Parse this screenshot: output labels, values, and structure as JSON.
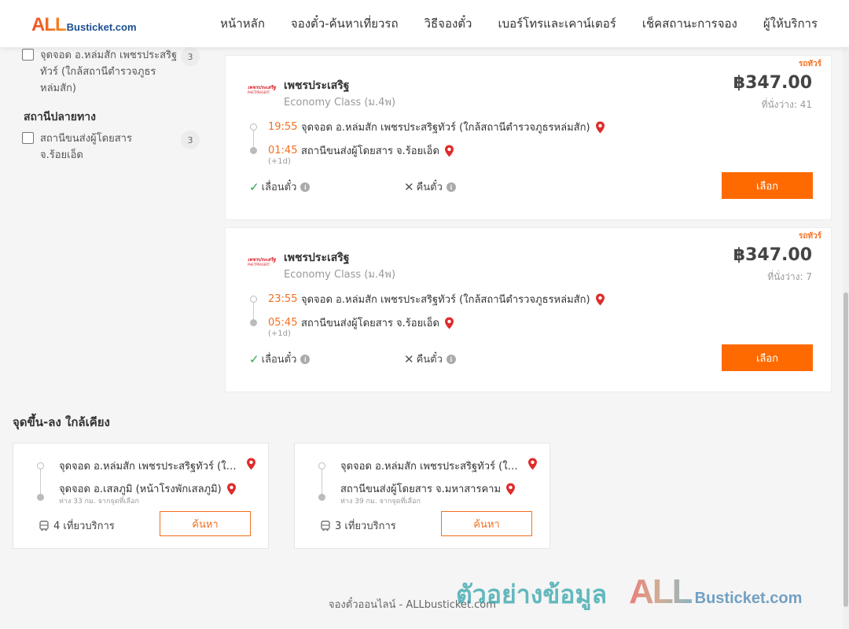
{
  "header": {
    "logo_all": "ALL",
    "logo_rest": "Busticket.com",
    "nav": [
      "หน้าหลัก",
      "จองตั๋ว-ค้นหาเที่ยวรถ",
      "วิธีจองตั๋ว",
      "เบอร์โทรและเคาน์เตอร์",
      "เช็คสถานะการจอง",
      "ผู้ให้บริการ"
    ]
  },
  "filters": {
    "origin_item": {
      "label": "จุดจอด อ.หล่มสัก เพชรประสริฐทัวร์ (ใกล้สถานีตำรวจภูธรหล่มสัก)",
      "count": "3"
    },
    "destination_heading": "สถานีปลายทาง",
    "destination_item": {
      "label": "สถานีขนส่งผู้โดยสาร จ.ร้อยเอ็ด",
      "count": "3"
    }
  },
  "trips": [
    {
      "tag": "รถทัวร์",
      "operator_logo_l1": "เพชรประเสริฐ",
      "operator_logo_l2": "PHETPRASERT",
      "operator": "เพชรประเสริฐ",
      "class": "Economy Class (ม.4พ)",
      "price": "฿347.00",
      "seats": "ที่นั่งว่าง: 41",
      "depart_time": "19:55",
      "depart_stop": "จุดจอด อ.หล่มสัก เพชรประสริฐทัวร์ (ใกล้สถานีตำรวจภูธรหล่มสัก)",
      "arrive_time": "01:45",
      "arrive_stop": "สถานีขนส่งผู้โดยสาร จ.ร้อยเอ็ด",
      "plus_day": "(+1d)",
      "reschedule": "เลื่อนตั๋ว",
      "refund": "คืนตั๋ว",
      "select_label": "เลือก"
    },
    {
      "tag": "รถทัวร์",
      "operator_logo_l1": "เพชรประเสริฐ",
      "operator_logo_l2": "PHETPRASERT",
      "operator": "เพชรประเสริฐ",
      "class": "Economy Class (ม.4พ)",
      "price": "฿347.00",
      "seats": "ที่นั่งว่าง: 7",
      "depart_time": "23:55",
      "depart_stop": "จุดจอด อ.หล่มสัก เพชรประสริฐทัวร์ (ใกล้สถานีตำรวจภูธรหล่มสัก)",
      "arrive_time": "05:45",
      "arrive_stop": "สถานีขนส่งผู้โดยสาร จ.ร้อยเอ็ด",
      "plus_day": "(+1d)",
      "reschedule": "เลื่อนตั๋ว",
      "refund": "คืนตั๋ว",
      "select_label": "เลือก"
    }
  ],
  "nearby": {
    "title": "จุดขึ้น-ลง ใกล้เคียง",
    "cards": [
      {
        "from": "จุดจอด อ.หล่มสัก เพชรประสริฐทัวร์ (ใกล้สถานีตำรวจภูธรหล่มสัก)",
        "to": "จุดจอด อ.เสลภูมิ (หน้าโรงพักเสลภูมิ)",
        "distance": "ห่าง 33 กม. จากจุดที่เลือก",
        "trips": "4 เที่ยวบริการ",
        "search_label": "ค้นหา"
      },
      {
        "from": "จุดจอด อ.หล่มสัก เพชรประสริฐทัวร์ (ใกล้สถานีตำรวจภูธรหล่มสัก)",
        "to": "สถานีขนส่งผู้โดยสาร จ.มหาสารคาม",
        "distance": "ห่าง 39 กม. จากจุดที่เลือก",
        "trips": "3 เที่ยวบริการ",
        "search_label": "ค้นหา"
      }
    ]
  },
  "footer": {
    "text": "จองตั๋วออนไลน์ - ALLbusticket.com",
    "watermark_text": "ตัวอย่างข้อมูล",
    "watermark_all": "ALL",
    "watermark_rest": "Busticket.com"
  },
  "colors": {
    "accent": "#ff6a00",
    "time": "#f37021",
    "pin": "#e02b2b",
    "check": "#2ea44f"
  },
  "icons": [
    "checkbox-icon",
    "map-pin-icon",
    "check-icon",
    "x-icon",
    "info-icon",
    "bus-icon"
  ]
}
